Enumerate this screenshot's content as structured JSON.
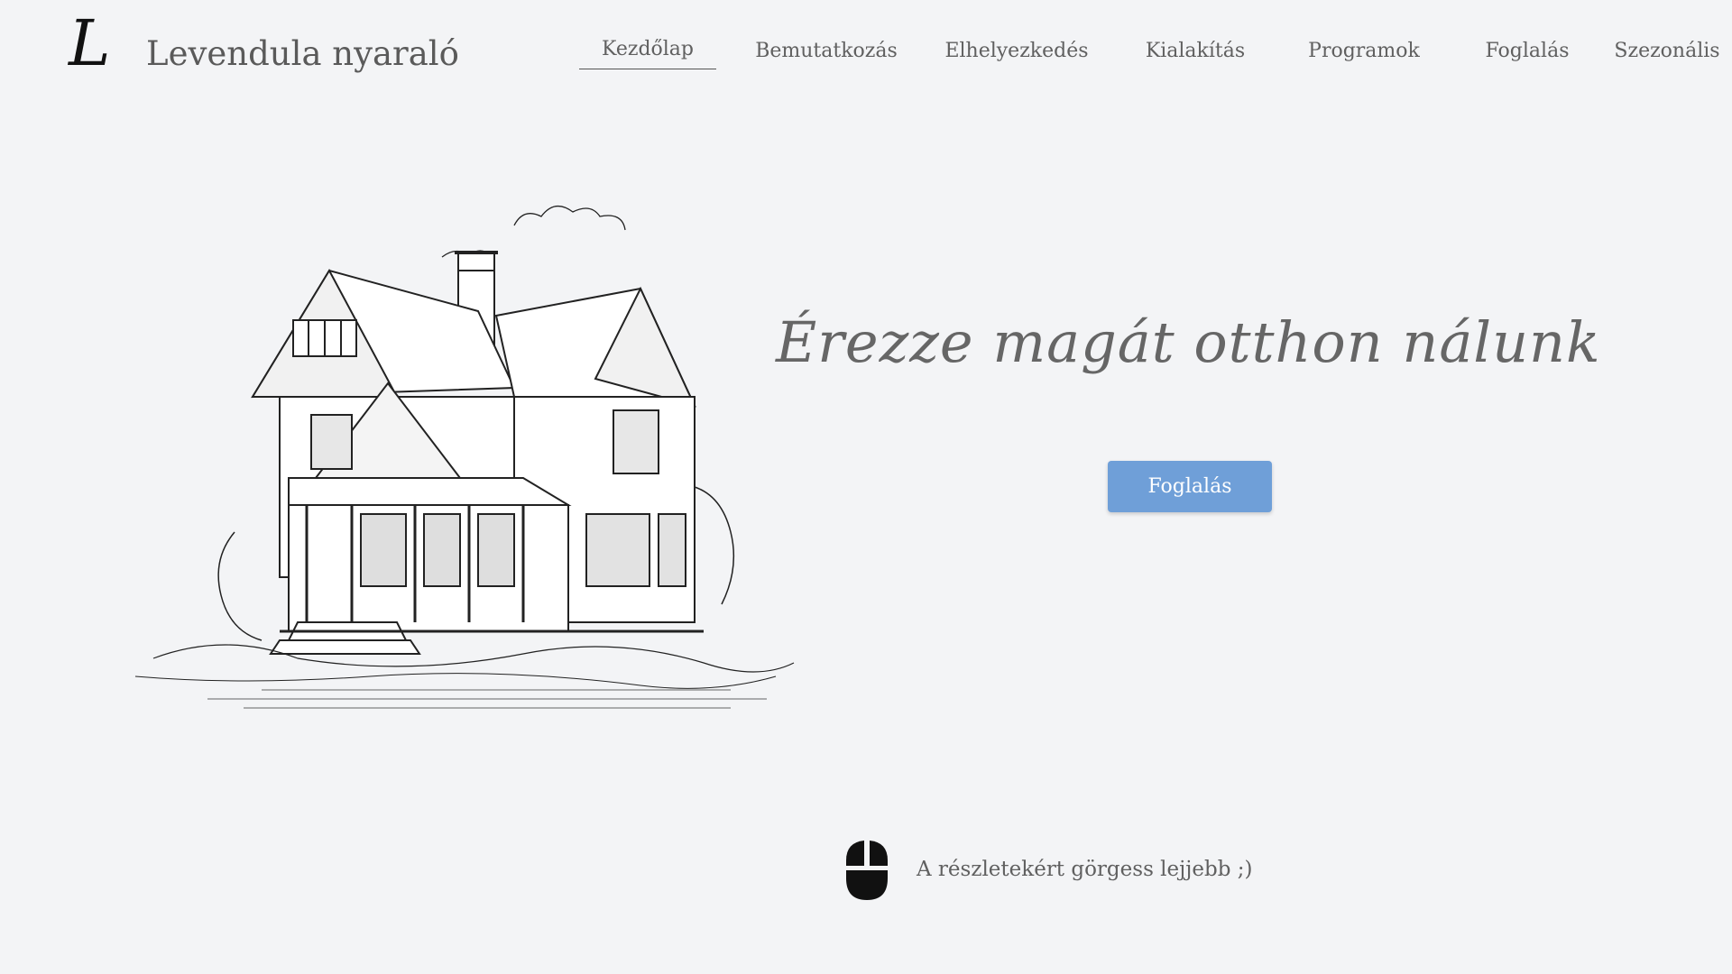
{
  "brand": {
    "logo_letter": "L",
    "name": "Levendula nyaraló"
  },
  "nav": {
    "items": [
      {
        "label": "Kezdőlap",
        "active": true
      },
      {
        "label": "Bemutatkozás",
        "active": false
      },
      {
        "label": "Elhelyezkedés",
        "active": false
      },
      {
        "label": "Kialakítás",
        "active": false
      },
      {
        "label": "Programok",
        "active": false
      },
      {
        "label": "Foglalás",
        "active": false
      },
      {
        "label": "Szezonális",
        "active": false
      }
    ]
  },
  "hero": {
    "image_icon": "house-sketch-illustration",
    "tagline": "Érezze magát otthon nálunk",
    "cta_label": "Foglalás"
  },
  "scroll_hint": {
    "icon": "mouse-icon",
    "text": "A részletekért görgess lejjebb ;)"
  },
  "colors": {
    "background": "#f3f4f6",
    "button": "#6f9fd8",
    "text": "#5f5f5f"
  }
}
